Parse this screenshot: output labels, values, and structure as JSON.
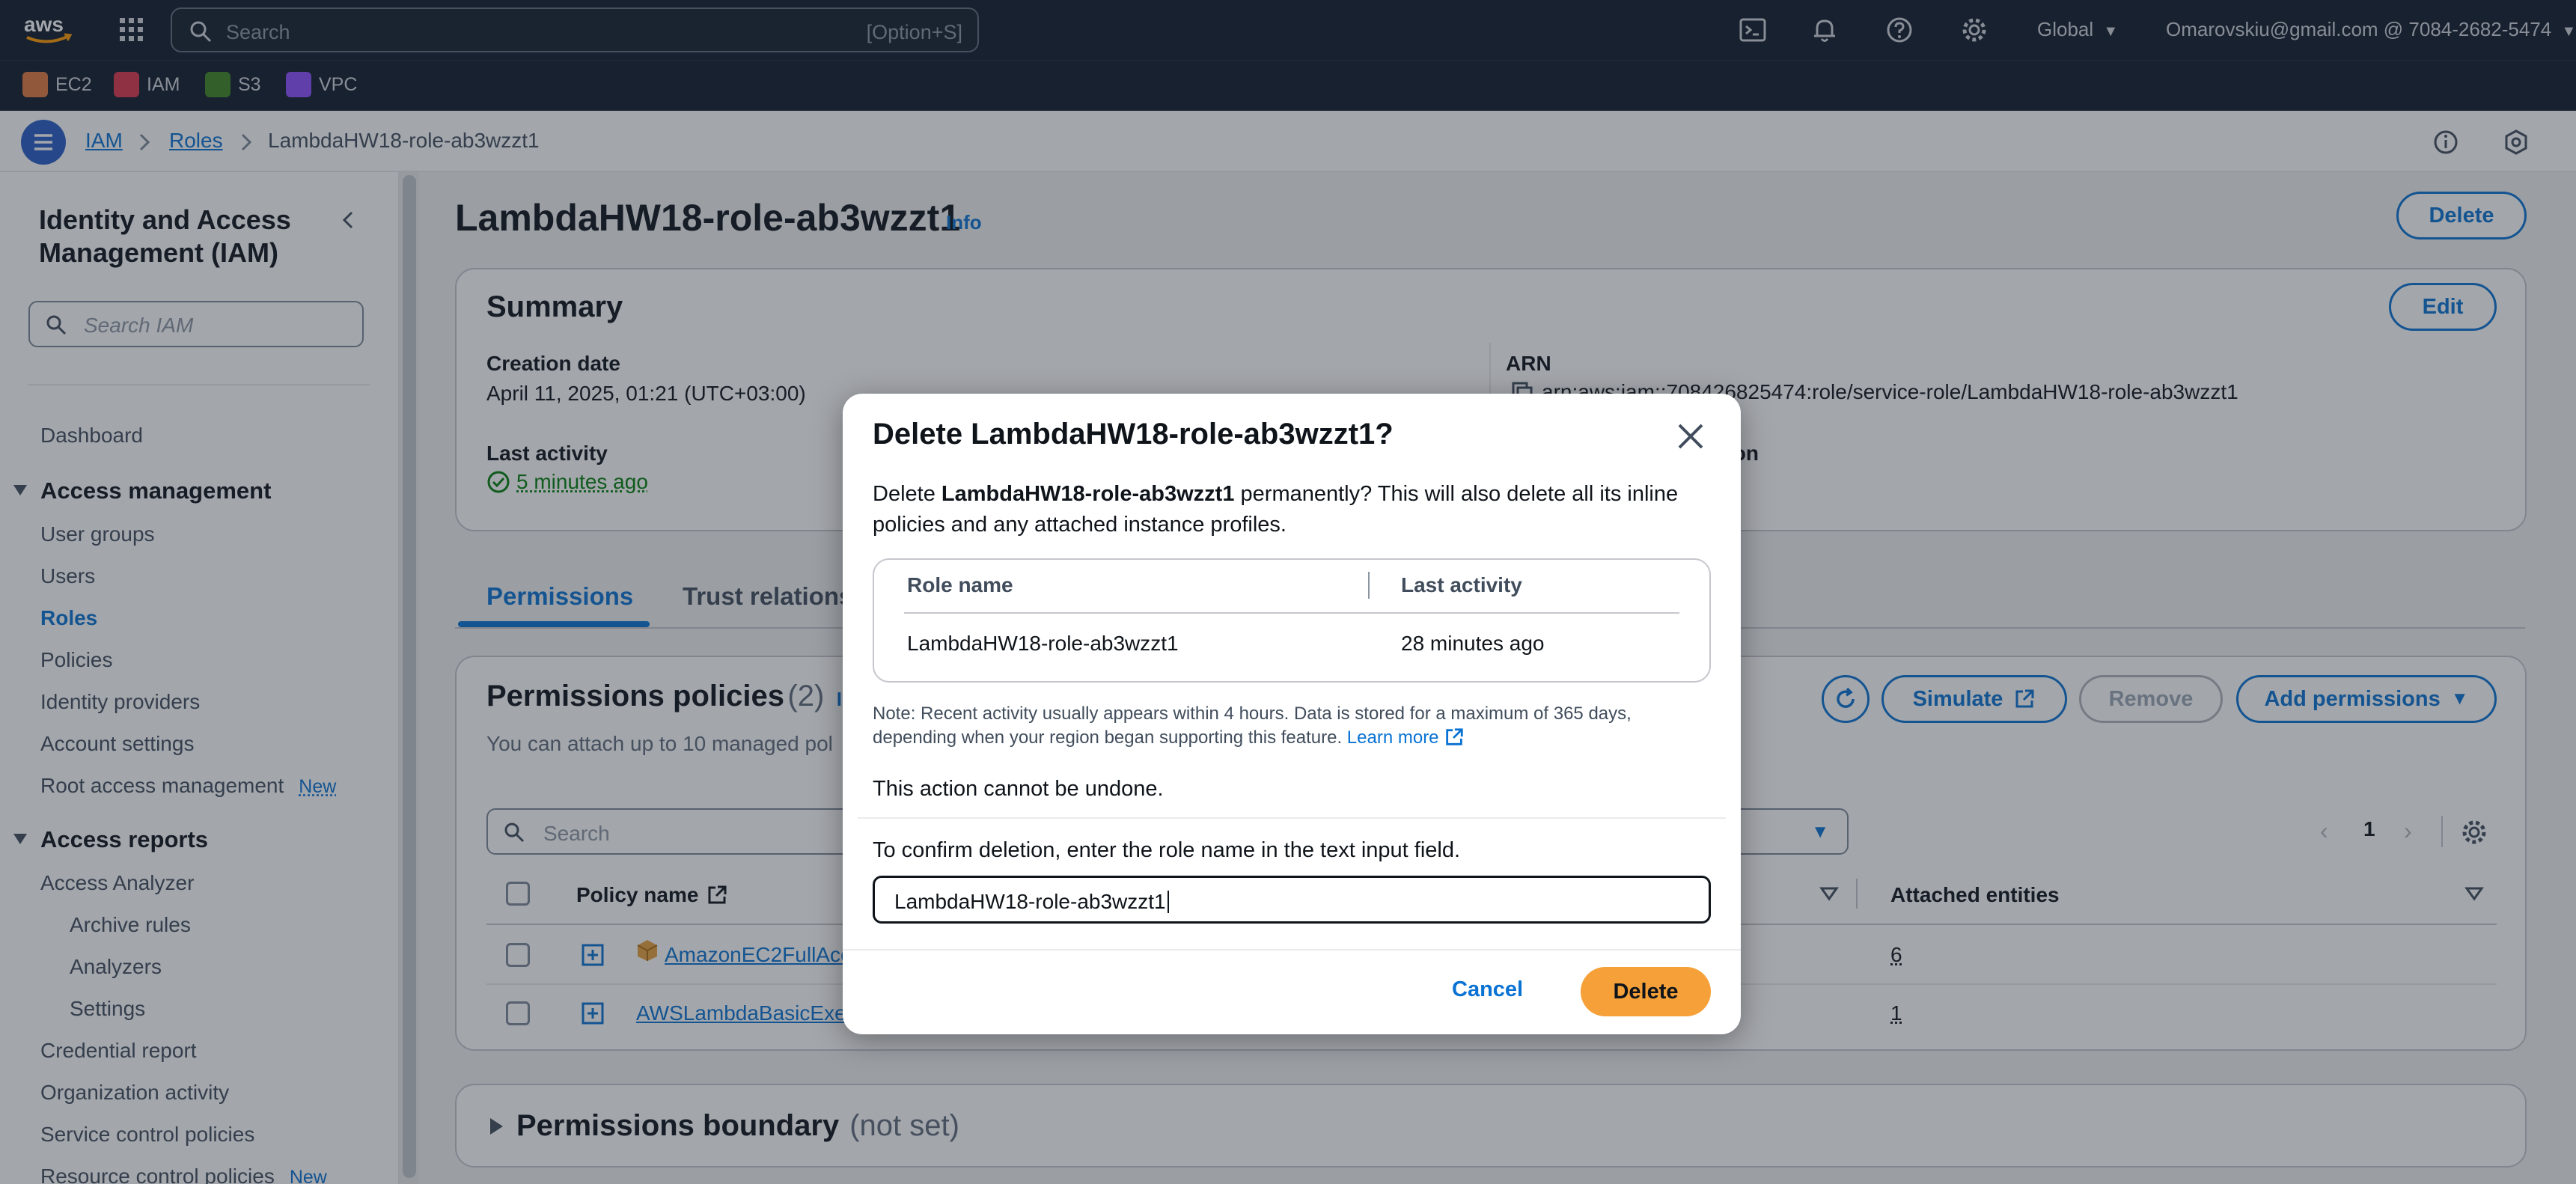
{
  "topnav": {
    "search_placeholder": "Search",
    "search_shortcut": "[Option+S]",
    "region": "Global",
    "account": "Omarovskiu@gmail.com @ 7084-2682-5474"
  },
  "services": [
    {
      "label": "EC2",
      "color": "#e07941"
    },
    {
      "label": "IAM",
      "color": "#dd344c"
    },
    {
      "label": "S3",
      "color": "#3f8624"
    },
    {
      "label": "VPC",
      "color": "#8c4fff"
    }
  ],
  "breadcrumb": {
    "items": [
      "IAM",
      "Roles"
    ],
    "current": "LambdaHW18-role-ab3wzzt1"
  },
  "sidebar": {
    "title": "Identity and Access Management (IAM)",
    "search_placeholder": "Search IAM",
    "dashboard": "Dashboard",
    "section_access_management": "Access management",
    "access_management_items": [
      "User groups",
      "Users",
      "Roles",
      "Policies",
      "Identity providers",
      "Account settings",
      "Root access management"
    ],
    "new_badge": "New",
    "section_access_reports": "Access reports",
    "access_analyzer": "Access Analyzer",
    "access_analyzer_sub": [
      "Archive rules",
      "Analyzers",
      "Settings"
    ],
    "report_items": [
      "Credential report",
      "Organization activity",
      "Service control policies",
      "Resource control policies"
    ]
  },
  "page": {
    "title": "LambdaHW18-role-ab3wzzt1",
    "info": "Info",
    "delete_button": "Delete",
    "summary": {
      "heading": "Summary",
      "edit_button": "Edit",
      "creation_date_label": "Creation date",
      "creation_date": "April 11, 2025, 01:21 (UTC+03:00)",
      "last_activity_label": "Last activity",
      "last_activity": "5 minutes ago",
      "arn_label": "ARN",
      "arn": "arn:aws:iam::708426825474:role/service-role/LambdaHW18-role-ab3wzzt1",
      "partial_label": "ion"
    },
    "tabs": [
      "Permissions",
      "Trust relations"
    ],
    "permissions": {
      "heading": "Permissions policies",
      "count": "(2)",
      "info_partial": "Info",
      "description": "You can attach up to 10 managed pol",
      "refresh_label": "",
      "simulate_button": "Simulate",
      "remove_button": "Remove",
      "add_button": "Add permissions",
      "search_placeholder": "Search",
      "page_number": "1",
      "col_policy_name": "Policy name",
      "col_attached": "Attached entities",
      "rows": [
        {
          "name": "AmazonEC2FullAcc",
          "attached": "6"
        },
        {
          "name": "AWSLambdaBasicExec",
          "attached": "1"
        }
      ]
    },
    "boundary": {
      "title": "Permissions boundary",
      "status": "(not set)"
    }
  },
  "modal": {
    "title": "Delete LambdaHW18-role-ab3wzzt1?",
    "body_prefix": "Delete ",
    "body_role": "LambdaHW18-role-ab3wzzt1",
    "body_suffix": " permanently? This will also delete all its inline policies and any attached instance profiles.",
    "col_role_name": "Role name",
    "col_last_activity": "Last activity",
    "row_role_name": "LambdaHW18-role-ab3wzzt1",
    "row_last_activity": "28 minutes ago",
    "note": "Note: Recent activity usually appears within 4 hours. Data is stored for a maximum of 365 days, depending when your region began supporting this feature.",
    "learn_more": "Learn more",
    "undone": "This action cannot be undone.",
    "confirm_text": "To confirm deletion, enter the role name in the text input field.",
    "input_value": "LambdaHW18-role-ab3wzzt1",
    "cancel_button": "Cancel",
    "delete_button": "Delete"
  },
  "colors": {
    "nav_bg": "#0f1b2a",
    "link": "#0972d3",
    "primary_button": "#f5a038",
    "success": "#037f0c"
  }
}
